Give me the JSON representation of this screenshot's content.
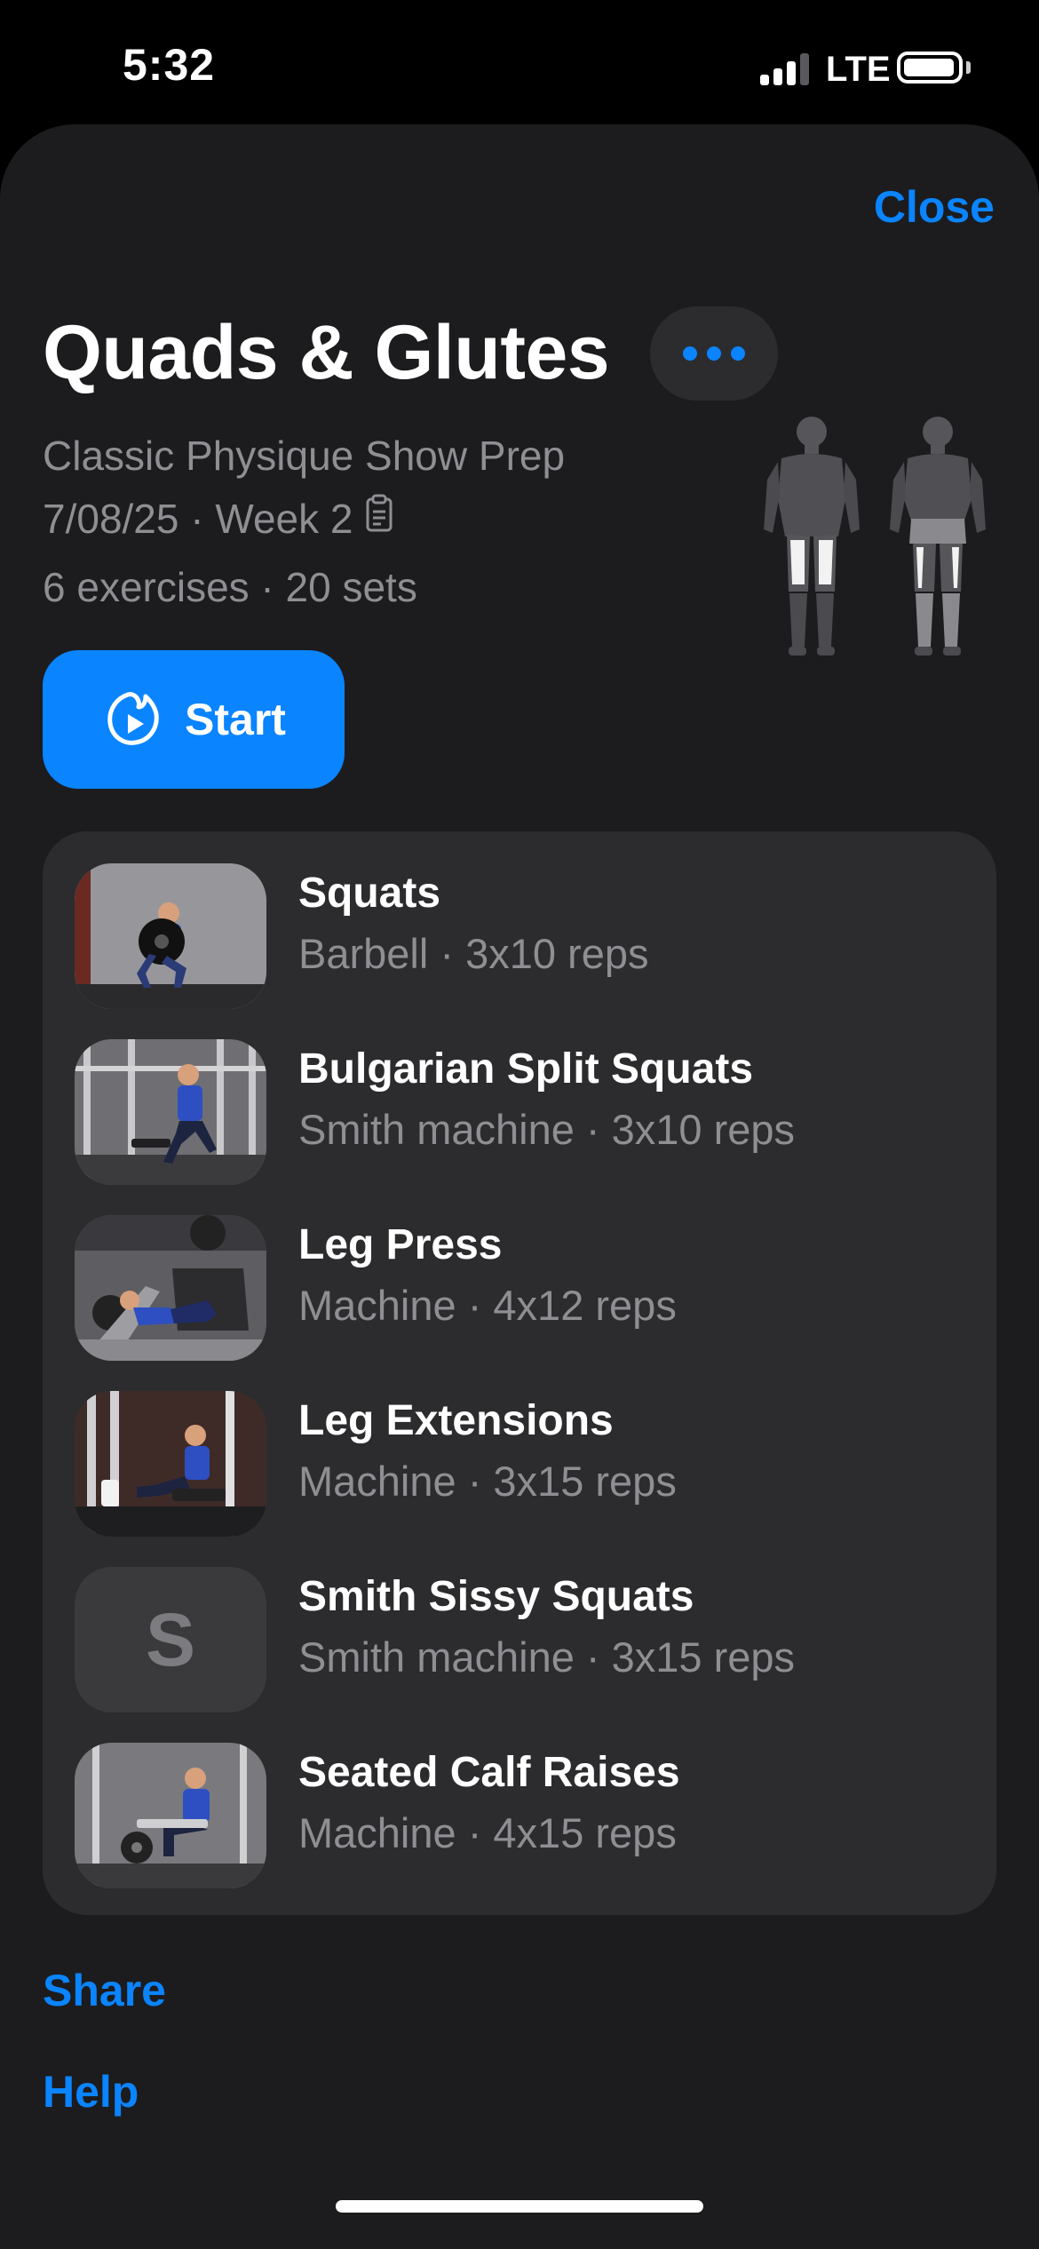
{
  "status_bar": {
    "time": "5:32",
    "network": "LTE"
  },
  "header": {
    "close_label": "Close",
    "title": "Quads & Glutes",
    "more_icon": "ellipsis-icon"
  },
  "workout": {
    "program": "Classic Physique Show Prep",
    "date_week": "7/08/25 · Week 2",
    "counts": "6 exercises · 20 sets",
    "muscles_highlighted": [
      "quadriceps",
      "hamstrings",
      "glutes"
    ]
  },
  "start_button": {
    "label": "Start",
    "icon": "play-flame-icon"
  },
  "exercises": [
    {
      "name": "Squats",
      "detail": "Barbell · 3x10 reps",
      "thumb": "photo"
    },
    {
      "name": "Bulgarian Split Squats",
      "detail": "Smith machine · 3x10 reps",
      "thumb": "photo"
    },
    {
      "name": "Leg Press",
      "detail": "Machine · 4x12 reps",
      "thumb": "photo"
    },
    {
      "name": "Leg Extensions",
      "detail": "Machine · 3x15 reps",
      "thumb": "photo"
    },
    {
      "name": "Smith Sissy Squats",
      "detail": "Smith machine · 3x15 reps",
      "thumb": "S"
    },
    {
      "name": "Seated Calf Raises",
      "detail": "Machine · 4x15 reps",
      "thumb": "photo"
    }
  ],
  "links": {
    "share": "Share",
    "help": "Help"
  },
  "colors": {
    "accent": "#0a84ff",
    "sheet_bg": "#1c1c1e",
    "card_bg": "#2c2c2e",
    "secondary_text": "#8e8e93"
  }
}
